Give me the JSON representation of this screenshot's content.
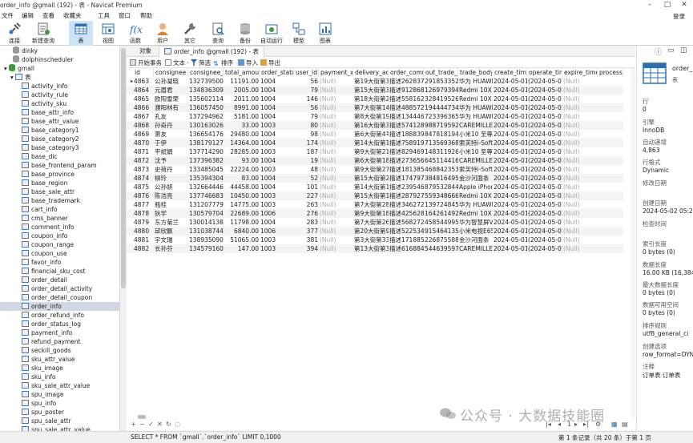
{
  "window": {
    "title": "order_info @gmall (192) - 表 - Navicat Premium"
  },
  "menubar": {
    "items": [
      "文件",
      "编辑",
      "查看",
      "收藏夹",
      "工具",
      "窗口",
      "帮助"
    ],
    "login": "登录"
  },
  "toolbar": {
    "items": [
      {
        "label": "连接",
        "icon": "connect-icon"
      },
      {
        "label": "新建查询",
        "icon": "new-query-icon"
      },
      {
        "label": "表",
        "icon": "table-icon"
      },
      {
        "label": "视图",
        "icon": "view-icon"
      },
      {
        "label": "函数",
        "icon": "function-icon"
      },
      {
        "label": "用户",
        "icon": "user-icon"
      },
      {
        "label": "其它",
        "icon": "tools-icon"
      },
      {
        "label": "查询",
        "icon": "query-icon"
      },
      {
        "label": "备份",
        "icon": "backup-icon"
      },
      {
        "label": "自动运行",
        "icon": "autorun-icon"
      },
      {
        "label": "模型",
        "icon": "model-icon"
      },
      {
        "label": "图表",
        "icon": "chart-icon"
      }
    ]
  },
  "sidebar": {
    "databases": [
      "dinky",
      "dolphinscheduler",
      "gmall"
    ],
    "tables_label": "表",
    "tables": [
      "activity_info",
      "activity_rule",
      "activity_sku",
      "base_attr_info",
      "base_attr_value",
      "base_category1",
      "base_category2",
      "base_category3",
      "base_dic",
      "base_frontend_param",
      "base_province",
      "base_region",
      "base_sale_attr",
      "base_trademark",
      "cart_info",
      "cms_banner",
      "comment_info",
      "coupon_info",
      "coupon_range",
      "coupon_use",
      "favor_info",
      "financial_sku_cost",
      "order_detail",
      "order_detail_activity",
      "order_detail_coupon",
      "order_info",
      "order_refund_info",
      "order_status_log",
      "payment_info",
      "refund_payment",
      "seckill_goods",
      "sku_attr_value",
      "sku_image",
      "sku_info",
      "sku_sale_attr_value",
      "spu_image",
      "spu_info",
      "spu_poster",
      "spu_sale_attr",
      "spu_sale_attr_value"
    ],
    "selected": "order_info"
  },
  "tabs": {
    "objects": "对象",
    "active": "order_info @gmall (192) - 表"
  },
  "subtoolbar": {
    "items": [
      "开始事务",
      "文本 ·",
      "筛选",
      "排序",
      "导入",
      "导出"
    ]
  },
  "grid": {
    "columns": [
      "id",
      "consignee",
      "consignee_tel",
      "total_amount",
      "order_status",
      "user_id",
      "payment_way",
      "delivery_address",
      "order_comment",
      "out_trade_no",
      "trade_body",
      "create_time",
      "operate_time",
      "expire_time",
      "process_st"
    ],
    "rows": [
      [
        "4863",
        "公孙凝晓",
        "13273950044",
        "11191.00",
        "1004",
        "56",
        "(Null)",
        "第19大街第31",
        "描述262837",
        "2918533525",
        "华为 HUAWE",
        "2024-05-01",
        "(2024-05-01",
        "(Null)",
        ""
      ],
      [
        "4864",
        "元眉君",
        "13483630927",
        "2005.00",
        "1004",
        "79",
        "(Null)",
        "第15大街第3",
        "描述912868",
        "1269793948",
        "Redmi 10X 4",
        "2024-05-01",
        "(2024-05-01",
        "(Null)",
        ""
      ],
      [
        "4865",
        "欧阳雪荣",
        "13560211458",
        "2011.00",
        "1004",
        "146",
        "(Null)",
        "第18大街第2",
        "描述558162",
        "3284195261",
        "Redmi 10X 4",
        "2024-05-01",
        "(2024-05-01",
        "(Null)",
        ""
      ],
      [
        "4866",
        "濮阳林有",
        "13605745052",
        "8991.00",
        "1004",
        "56",
        "(Null)",
        "第7大街第14",
        "描述488572",
        "1944447347",
        "华为 HUAWE",
        "2024-05-01",
        "(2024-05-01",
        "(Null)",
        ""
      ],
      [
        "4867",
        "孔友",
        "13729496251",
        "5181.00",
        "1004",
        "79",
        "(Null)",
        "第8大街第19",
        "描述134446",
        "7233963654",
        "华为 HUAWE",
        "2024-05-01",
        "(2024-05-01",
        "(Null)",
        ""
      ],
      [
        "4868",
        "孙奇丹",
        "13016302690",
        "33.00",
        "1003",
        "80",
        "(Null)",
        "第16大街第3",
        "描述574128",
        "9887195926",
        "CAREMILLE",
        "2024-05-01",
        "(2024-05-01",
        "(Null)",
        ""
      ],
      [
        "4869",
        "萧友",
        "13665417673",
        "29480.00",
        "1004",
        "98",
        "(Null)",
        "第6大街第4号",
        "描述188839",
        "8478181943",
        "小米10 至尊",
        "2024-05-01",
        "(2024-05-01",
        "(Null)",
        ""
      ],
      [
        "4870",
        "于伊",
        "13817912758",
        "14364.00",
        "1004",
        "174",
        "(Null)",
        "第14大街第1",
        "描述758919",
        "7135693685",
        "索芙特i-Soft",
        "2024-05-01",
        "(2024-05-01",
        "(Null)",
        ""
      ],
      [
        "4871",
        "平斌娟",
        "13771429078",
        "28285.00",
        "1003",
        "187",
        "(Null)",
        "第9大街第21",
        "描述829469",
        "1483119263",
        "小米10 至尊",
        "2024-05-01",
        "(2024-05-01",
        "(Null)",
        ""
      ],
      [
        "4872",
        "沈予",
        "13739638208",
        "93.00",
        "1004",
        "19",
        "(Null)",
        "第6大街第18",
        "描述273656",
        "6451144167",
        "CAREMILLE",
        "2024-05-01",
        "(2024-05-01",
        "(Null)",
        ""
      ],
      [
        "4873",
        "史荷丹",
        "13348504562",
        "22224.00",
        "1003",
        "48",
        "(Null)",
        "第9大街第27",
        "描述181385",
        "4688423534",
        "索芙特i-Soft",
        "2024-05-01",
        "(2024-05-01",
        "(Null)",
        ""
      ],
      [
        "4874",
        "柳玲",
        "13539430458",
        "83.00",
        "1004",
        "52",
        "(Null)",
        "第15大街第2",
        "描述174797",
        "3848164958",
        "金沙河面条",
        "2024-05-01",
        "(2024-05-01",
        "(Null)",
        ""
      ],
      [
        "4875",
        "公孙妍",
        "13266444605",
        "44458.00",
        "1004",
        "101",
        "(Null)",
        "第14大街第1",
        "描述239546",
        "8795328446",
        "Apple iPhon",
        "2024-05-01",
        "(2024-05-01",
        "(Null)",
        ""
      ],
      [
        "4876",
        "陈浩亮",
        "13774668322",
        "10450.00",
        "1003",
        "227",
        "(Null)",
        "第15大街第1",
        "描述287927",
        "5593486669",
        "Redmi 10X 4",
        "2024-05-01",
        "(2024-05-01",
        "(Null)",
        ""
      ],
      [
        "4877",
        "瓶桂",
        "13120777910",
        "14775.00",
        "1003",
        "263",
        "(Null)",
        "第7大街第28",
        "描述346272",
        "1397248455",
        "华为 HUAWE",
        "2024-05-01",
        "(2024-05-01",
        "(Null)",
        ""
      ],
      [
        "4878",
        "狄学",
        "13057970477",
        "22689.00",
        "1006",
        "276",
        "(Null)",
        "第9大街第18",
        "描述425628",
        "1642614924",
        "Redmi 10X 4",
        "2024-05-01",
        "(2024-05-01",
        "(Null)",
        ""
      ],
      [
        "4879",
        "东方菊兰",
        "13001413847",
        "11798.00",
        "1004",
        "283",
        "(Null)",
        "第7大街第26",
        "描述568272",
        "4585449957",
        "华为智慧屏V5",
        "2024-05-01",
        "(2024-05-01",
        "(Null)",
        ""
      ],
      [
        "4880",
        "邱欣飘",
        "13103874449",
        "6840.00",
        "1006",
        "377",
        "(Null)",
        "第20大街第9",
        "描述522534",
        "9154641351",
        "小米电视E65",
        "2024-05-01",
        "(2024-05-01",
        "(Null)",
        ""
      ],
      [
        "4881",
        "宇文瑞",
        "13893509016",
        "51065.00",
        "1003",
        "381",
        "(Null)",
        "第3大街第33",
        "描述171885",
        "2268755887",
        "金沙河面条",
        "2024-05-01",
        "(2024-05-01",
        "(Null)",
        ""
      ],
      [
        "4882",
        "长孙芬",
        "13457916059",
        "147.00",
        "1003",
        "394",
        "(Null)",
        "第13大街第3",
        "描述616884",
        "5446395972",
        "CAREMILLE",
        "2024-05-01",
        "(2024-05-01",
        "(Null)",
        ""
      ]
    ]
  },
  "infopanel": {
    "name": "order_",
    "type": "表",
    "fields": [
      {
        "label": "行",
        "value": "0"
      },
      {
        "label": "引擎",
        "value": "InnoDB"
      },
      {
        "label": "自动递增",
        "value": "4,863"
      },
      {
        "label": "行格式",
        "value": "Dynamic"
      },
      {
        "label": "修改日期",
        "value": ""
      },
      {
        "label": "创建日期",
        "value": "2024-05-02 05:28:"
      },
      {
        "label": "检查时间",
        "value": ""
      },
      {
        "label": "索引长度",
        "value": "0 bytes (0)"
      },
      {
        "label": "数据长度",
        "value": "16.00 KB (16,384)"
      },
      {
        "label": "最大数据长度",
        "value": "0 bytes (0)"
      },
      {
        "label": "数据可用空间",
        "value": "0 bytes (0)"
      },
      {
        "label": "排序规则",
        "value": "utf8_general_ci"
      },
      {
        "label": "创建选项",
        "value": "row_format=DYN/"
      },
      {
        "label": "注释",
        "value": "订单表 订单表"
      }
    ]
  },
  "status": {
    "sql": "SELECT * FROM `gmall`.`order_info` LIMIT 0,1000",
    "records": "第 1 条记录（共 20 条）于第 1 页"
  },
  "watermark": {
    "text": "公众号 · 大数据技能圈"
  }
}
